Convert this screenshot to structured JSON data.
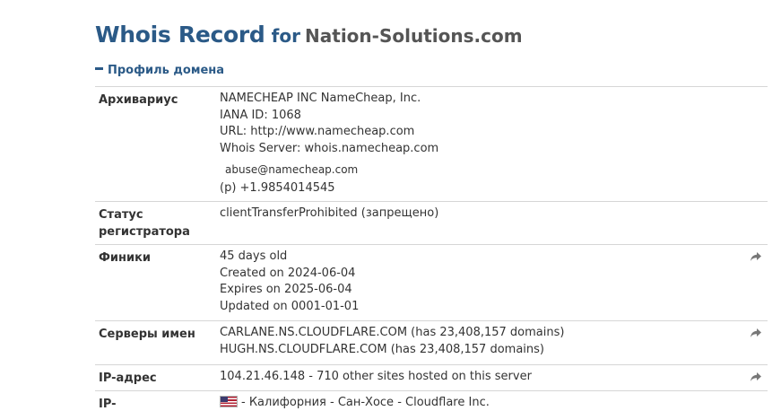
{
  "header": {
    "title_main": "Whois Record",
    "title_for": "for",
    "title_domain": "Nation-Solutions.com"
  },
  "section": {
    "title": "Профиль домена"
  },
  "rows": {
    "registrar": {
      "label": "Архивариус",
      "lines": [
        "NAMECHEAP INC NameCheap, Inc.",
        "IANA ID: 1068",
        "URL: http://www.namecheap.com",
        "Whois Server: whois.namecheap.com"
      ],
      "email": "abuse@namecheap.com",
      "phone": "(p)  +1.9854014545"
    },
    "registrar_status": {
      "label": "Статус регистратора",
      "value": "clientTransferProhibited (запрещено)"
    },
    "dates": {
      "label": "Финики",
      "lines": [
        "45 days old",
        "Created on 2024-06-04",
        "Expires on 2025-06-04",
        "Updated on 0001-01-01"
      ]
    },
    "name_servers": {
      "label": "Серверы имен",
      "lines": [
        "CARLANE.NS.CLOUDFLARE.COM (has 23,408,157 domains)",
        "HUGH.NS.CLOUDFLARE.COM (has 23,408,157 domains)"
      ]
    },
    "ip_address": {
      "label": "IP-адрес",
      "value": "104.21.46.148 - 710 other sites hosted on this server"
    },
    "ip_location": {
      "label": "IP-",
      "value": "- Калифорния - Сан-Хосе - Cloudflare Inc."
    }
  },
  "icons": {
    "share": "share-arrow-icon",
    "flag": "us-flag-icon"
  },
  "colors": {
    "title": "#2b5a87",
    "text": "#333333",
    "border": "#d6d6d6",
    "icon": "#777777"
  }
}
